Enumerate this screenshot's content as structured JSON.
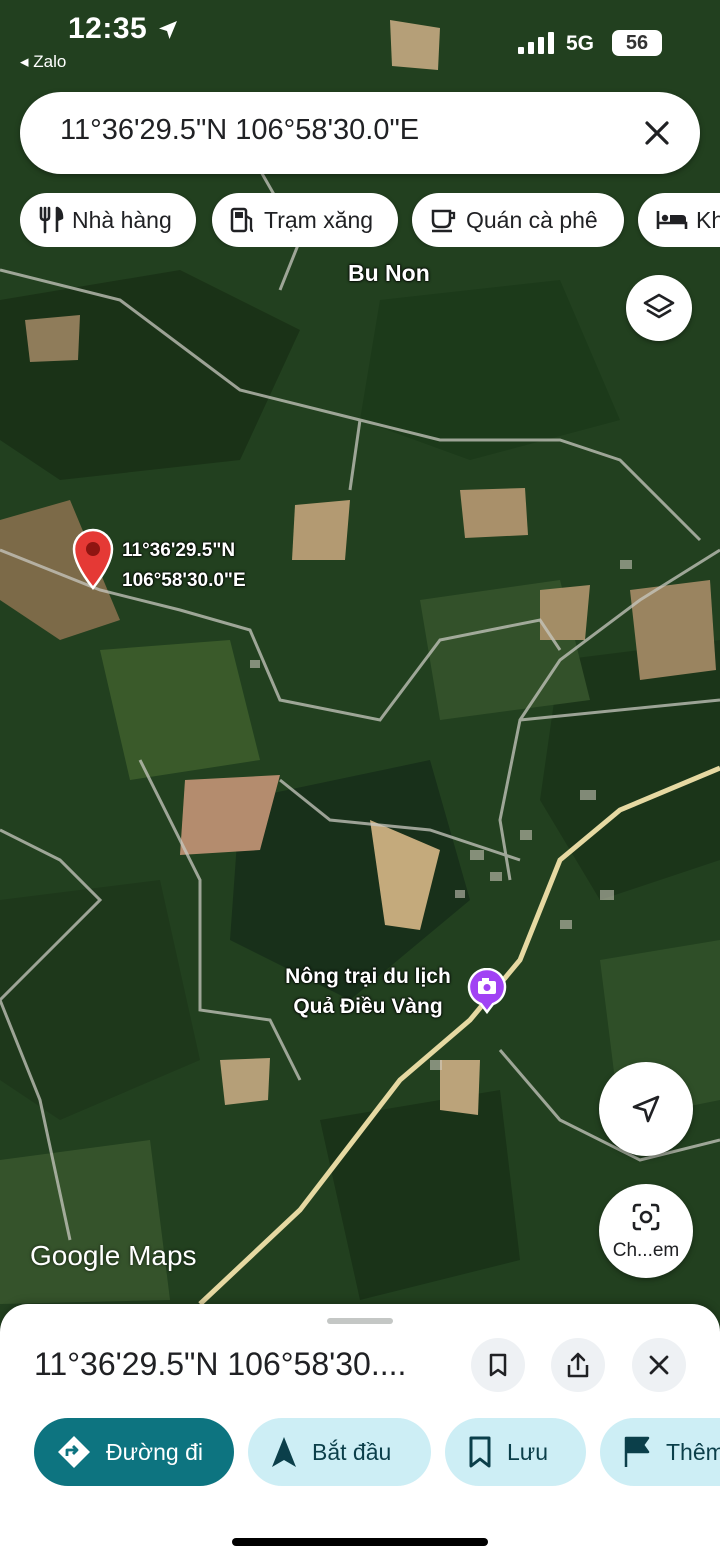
{
  "status_bar": {
    "time": "12:35",
    "back_app": "◂ Zalo",
    "network": "5G",
    "battery": "56"
  },
  "search": {
    "query": "11°36'29.5\"N 106°58'30.0\"E"
  },
  "chips": [
    {
      "label": "Nhà hàng",
      "icon": "restaurant-icon"
    },
    {
      "label": "Trạm xăng",
      "icon": "gas-station-icon"
    },
    {
      "label": "Quán cà phê",
      "icon": "coffee-icon"
    },
    {
      "label": "Khách sạn",
      "icon": "hotel-icon"
    }
  ],
  "map": {
    "place_label": "Bu Non",
    "pin_label_line1": "11°36'29.5\"N",
    "pin_label_line2": "106°58'30.0\"E",
    "poi_line1": "Nông trại du lịch",
    "poi_line2": "Quả Điều Vàng",
    "logo_text": "Google Maps",
    "lens_label": "Ch...em"
  },
  "sheet": {
    "title": "11°36'29.5\"N 106°58'30....",
    "actions": [
      {
        "label": "Đường đi",
        "icon": "directions-icon"
      },
      {
        "label": "Bắt đầu",
        "icon": "navigation-arrow-icon"
      },
      {
        "label": "Lưu",
        "icon": "bookmark-icon"
      },
      {
        "label": "Thêm",
        "icon": "flag-icon"
      }
    ]
  },
  "colors": {
    "primary_action": "#0d7480",
    "secondary_action": "#cdeef5",
    "pin": "#e53935",
    "poi": "#a142f4"
  }
}
